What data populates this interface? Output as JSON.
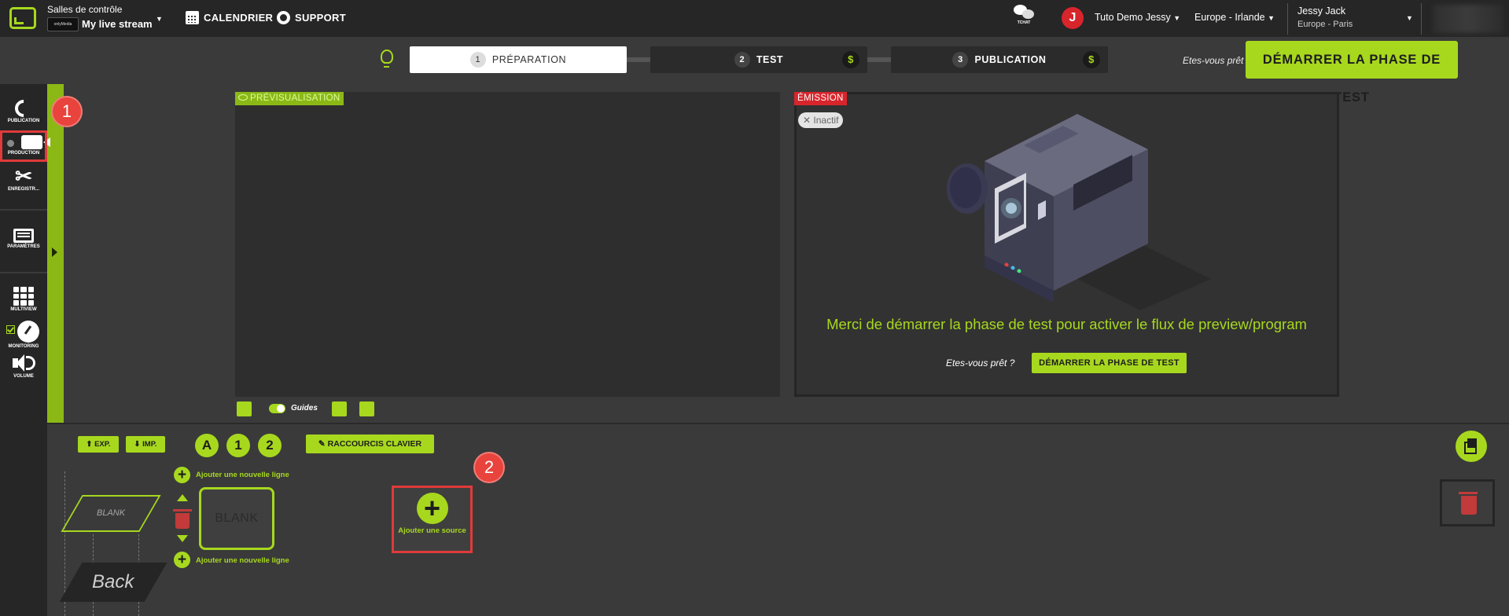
{
  "header": {
    "room_title": "Salles de contrôle",
    "room_brand": "onlyMedia",
    "room_name": "My live stream",
    "calendar_label": "CALENDRIER",
    "support_label": "SUPPORT",
    "tchat_label": "TCHAT",
    "avatar_initial": "J",
    "org_name": "Tuto Demo Jessy",
    "region": "Europe - Irlande",
    "user_name": "Jessy Jack",
    "user_timezone": "Europe - Paris"
  },
  "steps": [
    {
      "num": "1",
      "label": "PRÉPARATION",
      "active": true
    },
    {
      "num": "2",
      "label": "TEST",
      "paid": "$"
    },
    {
      "num": "3",
      "label": "PUBLICATION",
      "paid": "$"
    }
  ],
  "topbar_action": {
    "ready_text": "Etes-vous prêt",
    "start_label": "DÉMARRER LA PHASE DE TEST"
  },
  "sidebar": {
    "items": [
      {
        "label": "PUBLICATION",
        "icon": "satellite-icon"
      },
      {
        "label": "PRODUCTION",
        "icon": "video-camera-icon"
      },
      {
        "label": "ENREGISTR...",
        "icon": "scissors-icon"
      },
      {
        "label": "PARAMÈTRES",
        "icon": "settings-panel-icon"
      },
      {
        "label": "MULTIVIEW",
        "icon": "grid-icon"
      },
      {
        "label": "MONITORING",
        "icon": "gauge-icon"
      },
      {
        "label": "VOLUME",
        "icon": "speaker-icon"
      }
    ]
  },
  "annotations": {
    "badge1": "1",
    "badge2": "2"
  },
  "preview": {
    "tag": "PRÉVISUALISATION",
    "guides_label": "Guides"
  },
  "emission": {
    "tag": "ÉMISSION",
    "status": "Inactif",
    "message": "Merci de démarrer la phase de test pour activer le flux de preview/program",
    "ready_text": "Etes-vous prêt ?",
    "start_label": "DÉMARRER LA PHASE DE TEST"
  },
  "bottom": {
    "exp_label": "EXP.",
    "imp_label": "IMP.",
    "layer_a": "A",
    "layer_1": "1",
    "layer_2": "2",
    "shortcuts_label": "RACCOURCIS CLAVIER",
    "add_line_top": "Ajouter une nouvelle ligne",
    "add_line_bottom": "Ajouter une nouvelle ligne",
    "blank_card": "BLANK",
    "blank_layer": "BLANK",
    "back_layer": "Back",
    "add_source": "Ajouter une source"
  },
  "colors": {
    "accent": "#a7d81e",
    "live_red": "#d8252c",
    "annotation_red": "#e03a3a"
  }
}
